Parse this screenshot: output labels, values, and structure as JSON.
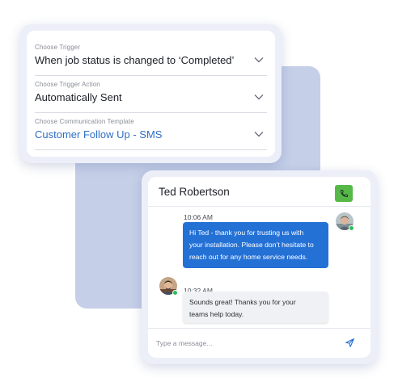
{
  "trigger_panel": {
    "fields": [
      {
        "label": "Choose Trigger",
        "value": "When job status is changed to ‘Completed’"
      },
      {
        "label": "Choose Trigger Action",
        "value": "Automatically Sent"
      },
      {
        "label": "Choose Communication Template",
        "value": "Customer Follow Up - SMS"
      }
    ],
    "accent_color": "#2f6fc4"
  },
  "chat": {
    "contact_name": "Ted Robertson",
    "call_button_icon": "phone-icon",
    "call_button_color": "#56b947",
    "messages": [
      {
        "direction": "outgoing",
        "time": "10:06 AM",
        "lines": [
          "Hi Ted - thank you for trusting us with",
          "your installation. Please don’t hesitate to",
          "reach out for any home service needs."
        ],
        "bubble_color": "#2471d6"
      },
      {
        "direction": "incoming",
        "time": "10:32 AM",
        "lines": [
          "Sounds great! Thanks you for your",
          "teams help today."
        ],
        "bubble_color": "#f0f1f4"
      }
    ],
    "composer": {
      "placeholder": "Type a message...",
      "value": "",
      "send_icon": "send-icon"
    },
    "online_color": "#2fbd57"
  }
}
